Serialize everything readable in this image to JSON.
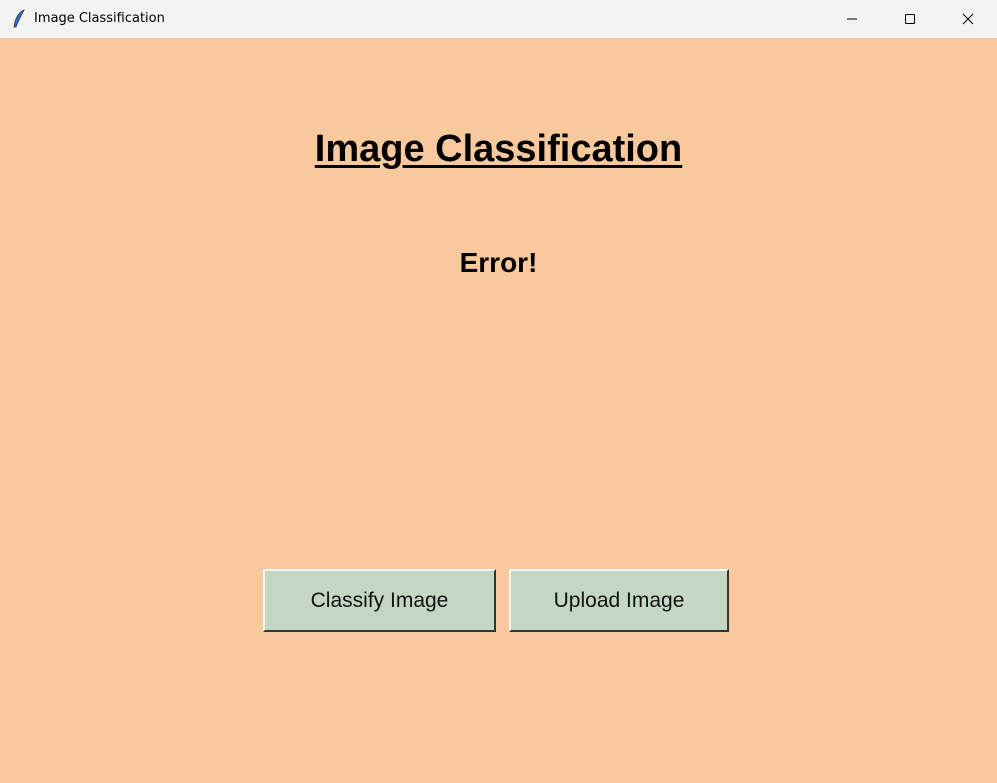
{
  "window": {
    "title": "Image Classification",
    "icon": "feather-icon"
  },
  "main": {
    "heading": "Image Classification",
    "status": "Error!"
  },
  "buttons": {
    "classify": "Classify Image",
    "upload": "Upload Image"
  },
  "colors": {
    "background": "#f9c99e",
    "button": "#c4d7c2"
  }
}
